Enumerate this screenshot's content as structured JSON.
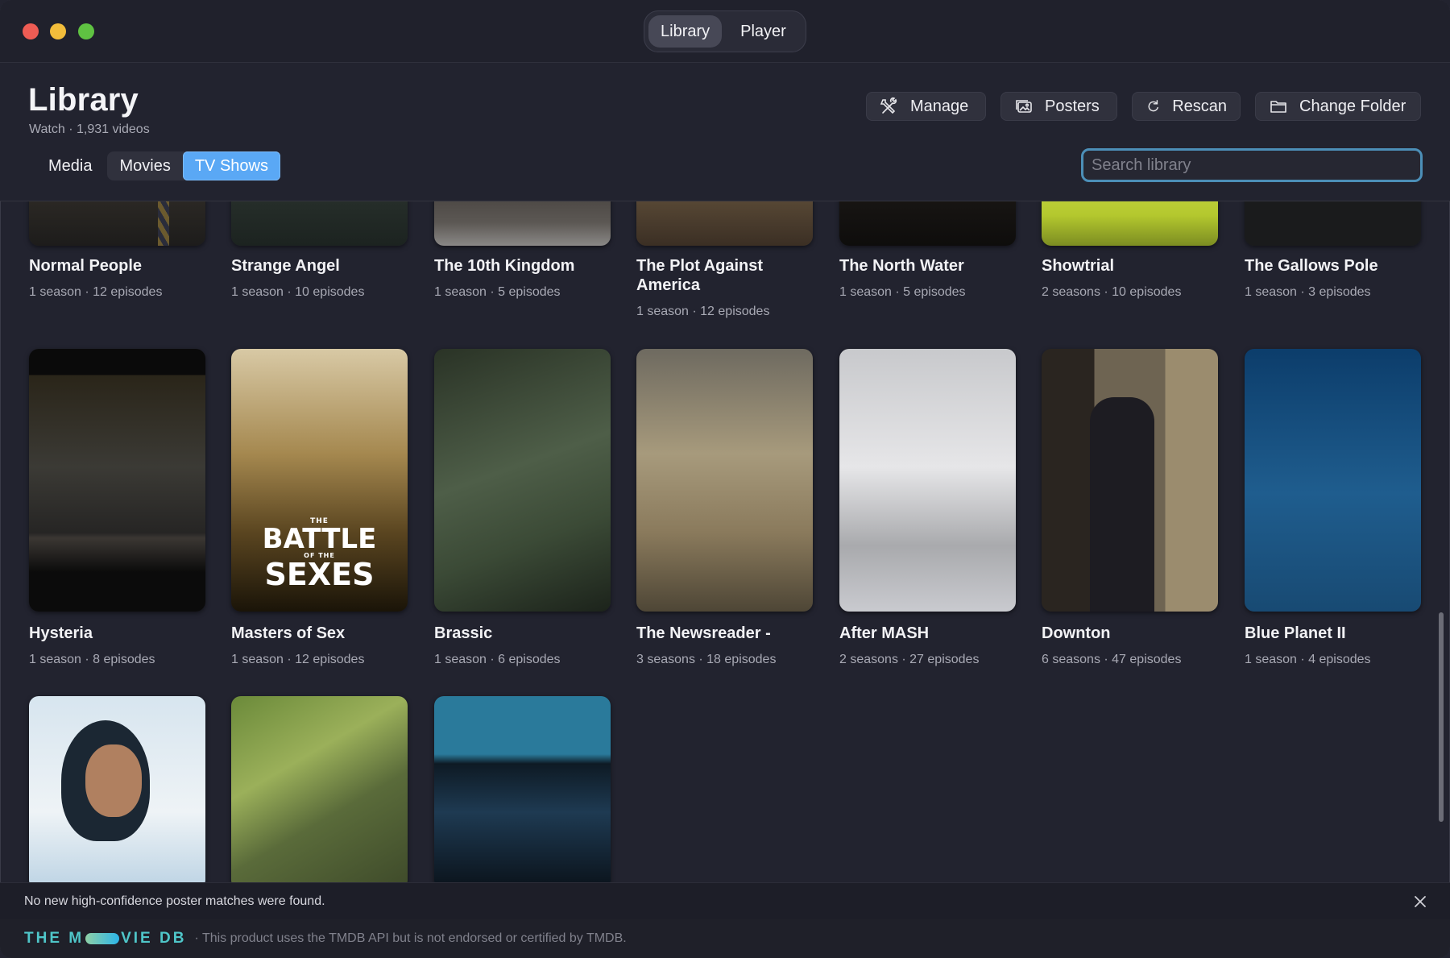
{
  "window": {
    "segmented": [
      {
        "label": "Library",
        "active": true
      },
      {
        "label": "Player",
        "active": false
      }
    ]
  },
  "header": {
    "title": "Library",
    "subtitle": "Watch · 1,931 videos",
    "actions": {
      "manage": "Manage",
      "posters": "Posters",
      "rescan": "Rescan",
      "change_folder": "Change Folder"
    },
    "tabs": [
      {
        "label": "Media"
      },
      {
        "label": "Movies"
      },
      {
        "label": "TV Shows",
        "active": true
      }
    ],
    "search": {
      "placeholder": "Search library",
      "value": ""
    }
  },
  "shows": [
    {
      "title": "Normal People",
      "meta": "1 season · 12 episodes"
    },
    {
      "title": "Strange Angel",
      "meta": "1 season · 10 episodes"
    },
    {
      "title": "The 10th Kingdom",
      "meta": "1 season · 5 episodes"
    },
    {
      "title": "The Plot Against America",
      "meta": "1 season · 12 episodes"
    },
    {
      "title": "The North Water",
      "meta": "1 season · 5 episodes"
    },
    {
      "title": "Showtrial",
      "meta": "2 seasons · 10 episodes"
    },
    {
      "title": "The Gallows Pole",
      "meta": "1 season · 3 episodes"
    },
    {
      "title": "Hysteria",
      "meta": "1 season · 8 episodes"
    },
    {
      "title": "Masters of Sex",
      "meta": "1 season · 12 episodes"
    },
    {
      "title": "Brassic",
      "meta": "1 season · 6 episodes"
    },
    {
      "title": "The Newsreader -",
      "meta": "3 seasons · 18 episodes"
    },
    {
      "title": "After MASH",
      "meta": "2 seasons · 27 episodes"
    },
    {
      "title": "Downton",
      "meta": "6 seasons · 47 episodes"
    },
    {
      "title": "Blue Planet II",
      "meta": "1 season · 4 episodes"
    }
  ],
  "poster_text": {
    "masters_of_sex": {
      "small": "THE",
      "big1": "BATTLE",
      "of_the": "OF THE",
      "big2": "SEXES"
    }
  },
  "banner": {
    "message": "No new high-confidence poster matches were found."
  },
  "footer": {
    "brand_left": "THE M",
    "brand_right": "VIE DB",
    "note": "· This product uses the TMDB API but is not endorsed or certified by TMDB."
  },
  "colors": {
    "accent": "#5aa8f5",
    "background": "#22232f"
  }
}
